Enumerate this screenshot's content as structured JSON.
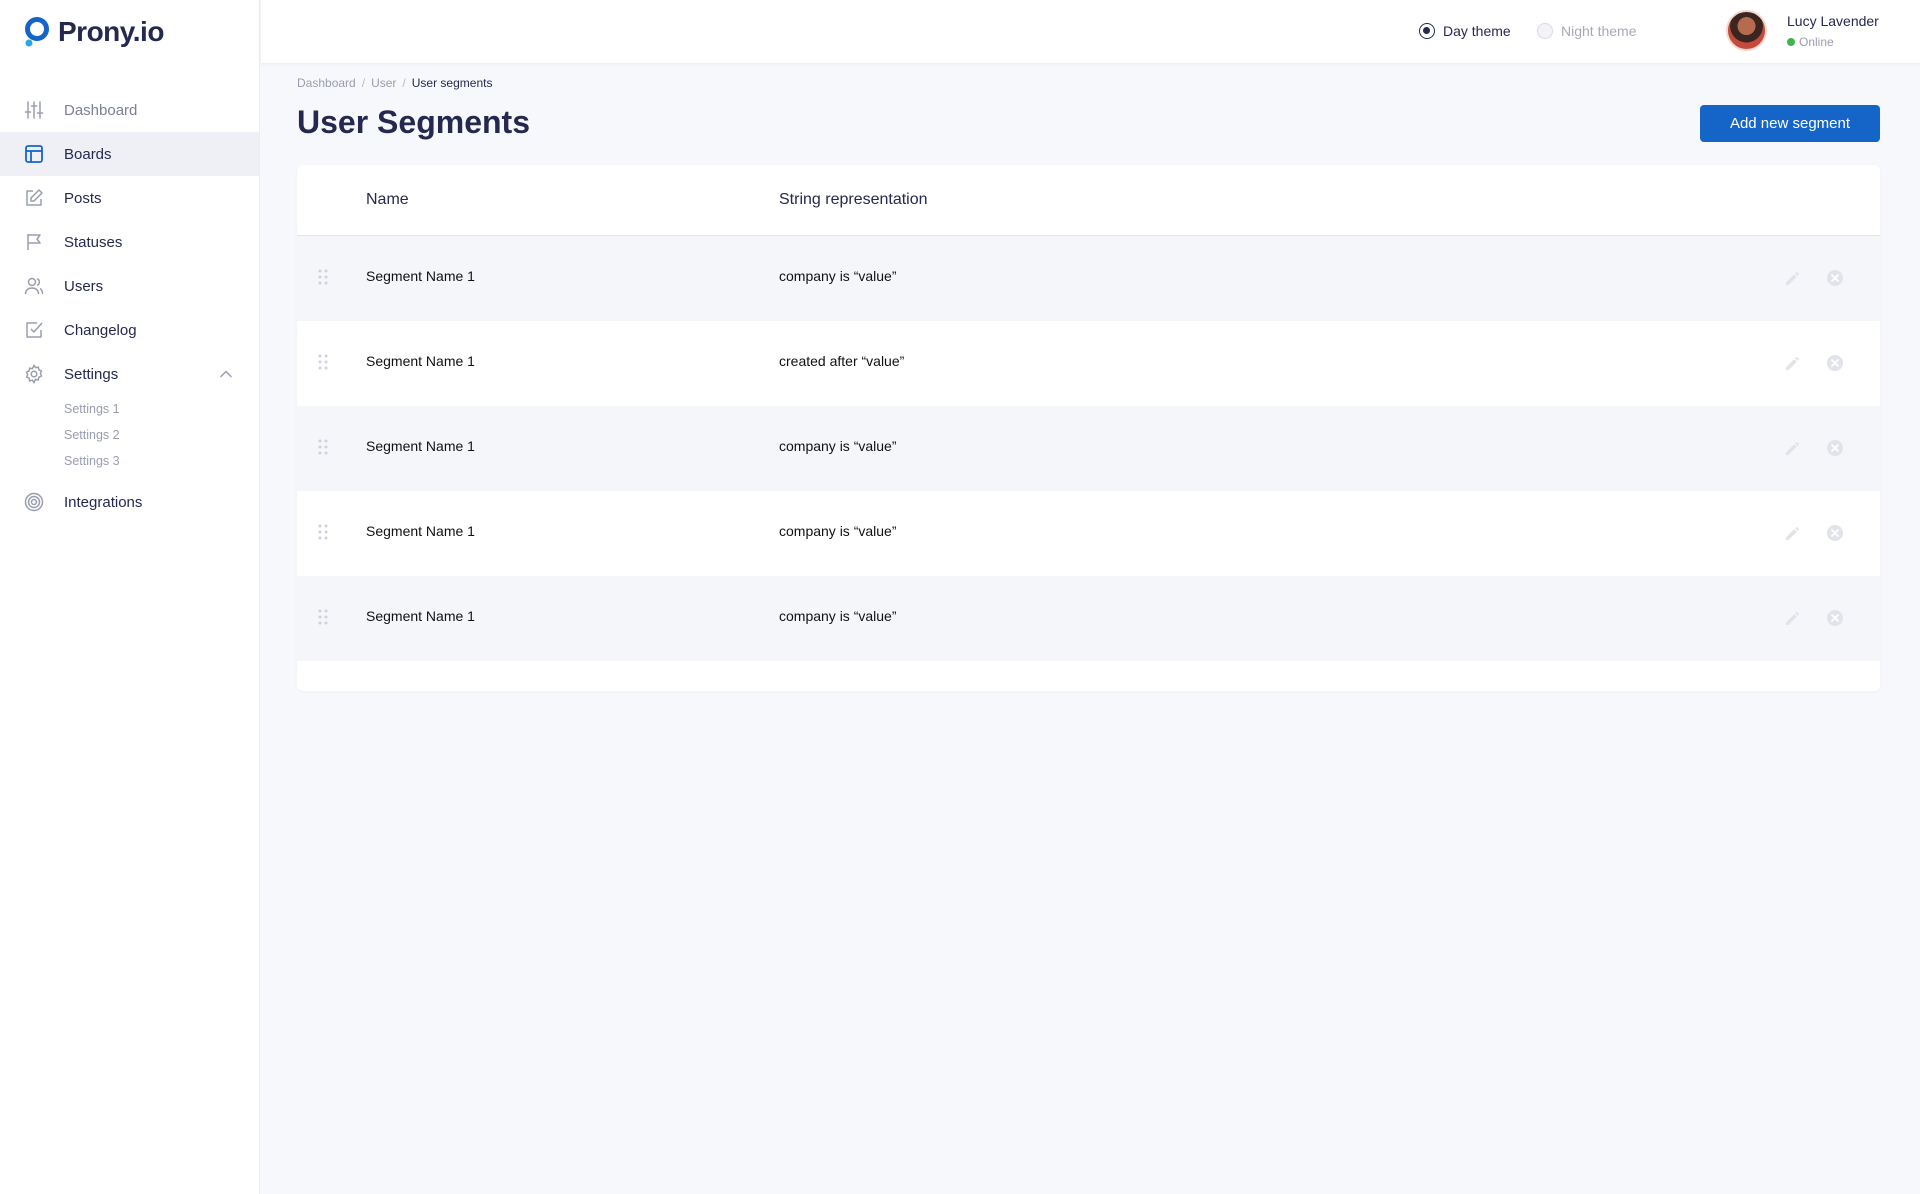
{
  "brand": {
    "name": "Prony.io",
    "accent": "#1565c8"
  },
  "sidebar": {
    "items": [
      {
        "label": "Dashboard",
        "icon": "sliders-icon"
      },
      {
        "label": "Boards",
        "icon": "layout-icon"
      },
      {
        "label": "Posts",
        "icon": "edit-icon"
      },
      {
        "label": "Statuses",
        "icon": "flag-icon"
      },
      {
        "label": "Users",
        "icon": "users-icon"
      },
      {
        "label": "Changelog",
        "icon": "check-square-icon"
      },
      {
        "label": "Settings",
        "icon": "gear-icon"
      },
      {
        "label": "Integrations",
        "icon": "target-icon"
      }
    ],
    "settings_sub": [
      "Settings 1",
      "Settings 2",
      "Settings 3"
    ]
  },
  "topbar": {
    "day_theme": "Day theme",
    "night_theme": "Night theme",
    "user_name": "Lucy Lavender",
    "user_status": "Online"
  },
  "breadcrumb": [
    "Dashboard",
    "User",
    "User segments"
  ],
  "page": {
    "title": "User Segments",
    "add_button": "Add new segment"
  },
  "table": {
    "columns": [
      "Name",
      "String representation"
    ],
    "rows": [
      {
        "name": "Segment Name 1",
        "string": "company is “value”"
      },
      {
        "name": "Segment Name 1",
        "string": "created after “value”"
      },
      {
        "name": "Segment Name 1",
        "string": "company is “value”"
      },
      {
        "name": "Segment Name 1",
        "string": "company is “value”"
      },
      {
        "name": "Segment Name 1",
        "string": "company is “value”"
      }
    ]
  }
}
